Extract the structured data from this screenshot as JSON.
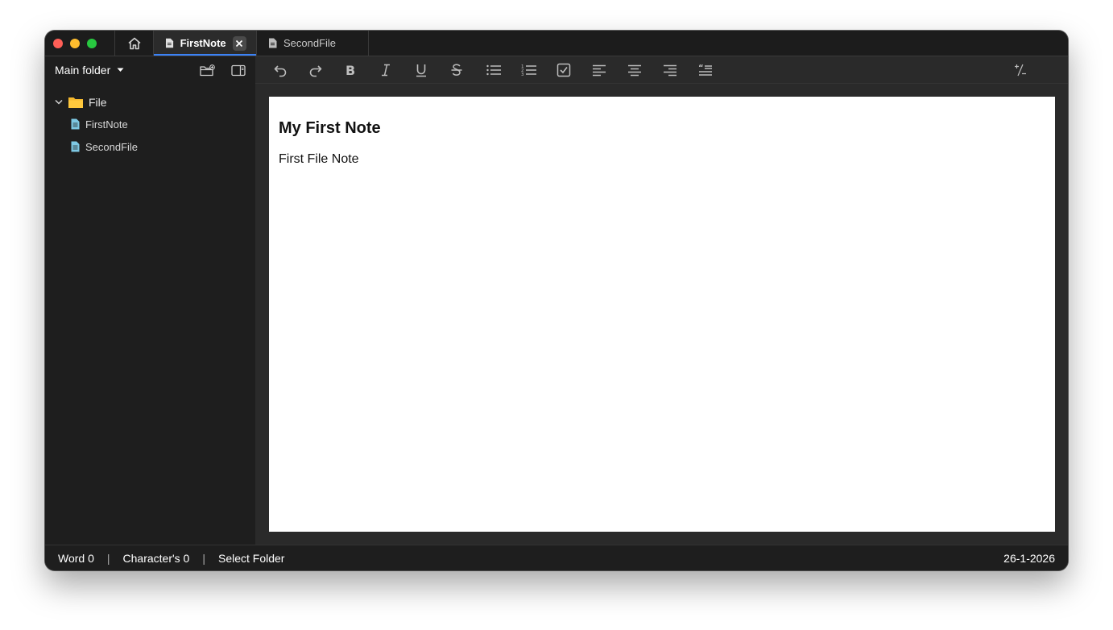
{
  "tabs": {
    "home_icon": "home-icon",
    "items": [
      {
        "label": "FirstNote",
        "active": true,
        "icon": "document-icon"
      },
      {
        "label": "SecondFile",
        "active": false,
        "icon": "document-icon"
      }
    ]
  },
  "sidebar": {
    "title": "Main folder",
    "tree": {
      "folder": {
        "label": "File",
        "icon": "folder-icon"
      },
      "files": [
        {
          "label": "FirstNote",
          "icon": "document-icon"
        },
        {
          "label": "SecondFile",
          "icon": "document-icon"
        }
      ]
    }
  },
  "toolbar": {
    "buttons": [
      "undo-icon",
      "redo-icon",
      "bold-icon",
      "italic-icon",
      "underline-icon",
      "strikethrough-icon",
      "bullet-list-icon",
      "numbered-list-icon",
      "checkbox-icon",
      "align-left-icon",
      "align-center-icon",
      "align-right-icon",
      "quote-icon"
    ],
    "right_label": "⁺∕₋"
  },
  "editor": {
    "heading": "My First Note",
    "body": "First File Note"
  },
  "status": {
    "words": "Word 0",
    "characters": "Character's 0",
    "folder": "Select Folder",
    "separator": "|",
    "date": "26-1-2026"
  },
  "colors": {
    "accent": "#3b82f6",
    "folder": "#f5b82e",
    "file": "#7ec8e3",
    "background": "#1e1e1e",
    "paper": "#ffffff"
  }
}
